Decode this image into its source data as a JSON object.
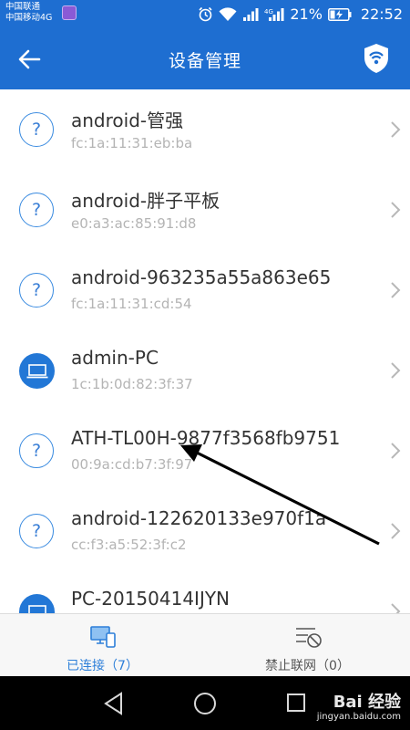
{
  "status_bar": {
    "carrier_line1": "中国联通",
    "carrier_line2": "中国移动4G",
    "battery_percent": "21%",
    "time": "22:52",
    "network_badge": "4G"
  },
  "header": {
    "title": "设备管理",
    "back_icon": "arrow-left-icon",
    "shield_icon": "wifi-shield-icon"
  },
  "devices": [
    {
      "name": "android-管强",
      "mac": "fc:1a:11:31:eb:ba",
      "type": "unknown"
    },
    {
      "name": "android-胖子平板",
      "mac": "e0:a3:ac:85:91:d8",
      "type": "unknown"
    },
    {
      "name": "android-963235a55a863e65",
      "mac": "fc:1a:11:31:cd:54",
      "type": "unknown"
    },
    {
      "name": "admin-PC",
      "mac": "1c:1b:0d:82:3f:37",
      "type": "pc"
    },
    {
      "name": "ATH-TL00H-9877f3568fb9751",
      "mac": "00:9a:cd:b7:3f:97",
      "type": "unknown"
    },
    {
      "name": "android-122620133e970f1a",
      "mac": "cc:f3:a5:52:3f:c2",
      "type": "unknown"
    },
    {
      "name": "PC-20150414IJYN",
      "mac": "",
      "type": "pc"
    }
  ],
  "tabs": {
    "connected_label": "已连接（7）",
    "blocked_label": "禁止联网（0）"
  },
  "watermark": {
    "brand": "Bai 经验",
    "site": "jingyan.baidu.com"
  },
  "colors": {
    "brand_blue": "#1e6ed1",
    "active_tab": "#2d7fd9"
  }
}
